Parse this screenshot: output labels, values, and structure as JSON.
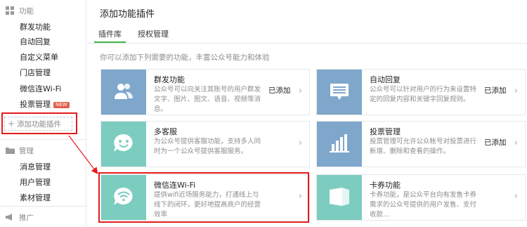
{
  "sidebar": {
    "function_section": "功能",
    "function_items": [
      "群发功能",
      "自动回复",
      "自定义菜单",
      "门店管理",
      "微信连Wi-Fi",
      "投票管理"
    ],
    "new_badge": "NEW",
    "add_plugin": "添加功能插件",
    "manage_section": "管理",
    "manage_items": [
      "消息管理",
      "用户管理",
      "素材管理"
    ],
    "promo_section": "推广"
  },
  "main": {
    "title": "添加功能插件",
    "tabs": [
      "插件库",
      "授权管理"
    ],
    "intro": "你可以添加下列需要的功能，丰富公众号能力和体验",
    "cards": [
      {
        "name": "群发功能",
        "desc": "公众号可以向关注其账号的用户群发文字、图片、图文、语音、视频等消息。",
        "status": "已添加",
        "color": "#7fa7cc",
        "icon": "users-icon"
      },
      {
        "name": "自动回复",
        "desc": "公众号可以针对用户的行为来设置特定的回复内容和关键字回复规则。",
        "status": "已添加",
        "color": "#7fa7cc",
        "icon": "message-icon"
      },
      {
        "name": "多客服",
        "desc": "为公众号提供客服功能，支持多人同时为一个公众号提供客服服务。",
        "status": "",
        "color": "#7ccdc0",
        "icon": "smile-icon"
      },
      {
        "name": "投票管理",
        "desc": "投票管理可允许公众帐号对投票进行新增、删除和查看的操作。",
        "status": "已添加",
        "color": "#7fa7cc",
        "icon": "bar-chart-icon"
      },
      {
        "name": "微信连Wi-Fi",
        "desc": "提供wifi近场服务能力，打通线上与线下的闭环，更好地提高商户的经营效率",
        "status": "",
        "color": "#7ccdc0",
        "icon": "wifi-icon"
      },
      {
        "name": "卡券功能",
        "desc": "卡券功能，是公众平台向有发售卡券需求的公众号提供的用户发售、支付收款…",
        "status": "",
        "color": "#7ccdc0",
        "icon": "card-icon"
      }
    ],
    "chevron": "›"
  }
}
